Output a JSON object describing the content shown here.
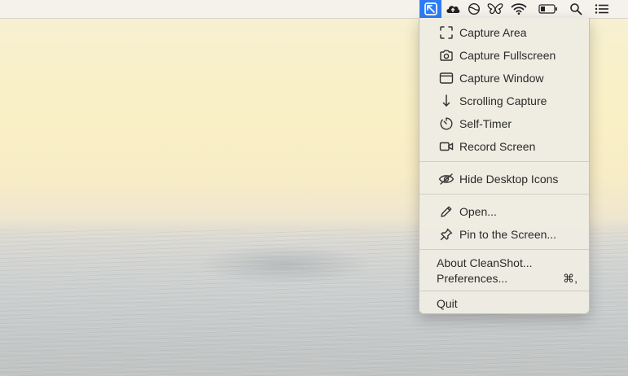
{
  "menubar": {
    "icons": [
      {
        "name": "cleanshot-icon",
        "active": true
      },
      {
        "name": "cloud-upload-icon"
      },
      {
        "name": "circle-app-icon"
      },
      {
        "name": "butterfly-icon"
      },
      {
        "name": "wifi-icon"
      },
      {
        "name": "battery-icon"
      },
      {
        "name": "spotlight-search-icon"
      },
      {
        "name": "notification-center-icon"
      }
    ],
    "accent": "#2d7cf6"
  },
  "menu": {
    "items": [
      {
        "label": "Capture Area",
        "icon": "capture-area-icon"
      },
      {
        "label": "Capture Fullscreen",
        "icon": "camera-icon"
      },
      {
        "label": "Capture Window",
        "icon": "window-icon"
      },
      {
        "label": "Scrolling Capture",
        "icon": "arrow-down-icon"
      },
      {
        "label": "Self-Timer",
        "icon": "timer-icon"
      },
      {
        "label": "Record Screen",
        "icon": "video-camera-icon"
      },
      {
        "label": "Hide Desktop Icons",
        "icon": "eye-slash-icon"
      },
      {
        "label": "Open...",
        "icon": "pencil-icon"
      },
      {
        "label": "Pin to the Screen...",
        "icon": "pin-icon"
      },
      {
        "label": "About CleanShot..."
      },
      {
        "label": "Preferences...",
        "shortcut": "⌘,"
      },
      {
        "label": "Quit"
      }
    ]
  }
}
